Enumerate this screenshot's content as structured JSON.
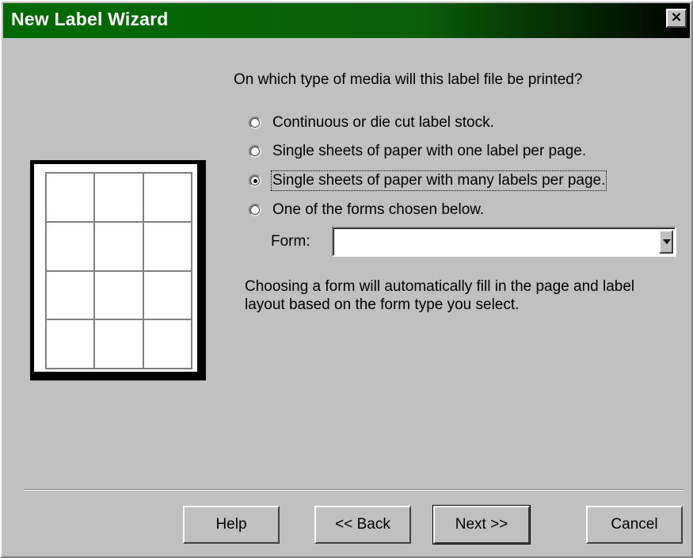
{
  "window": {
    "title": "New Label Wizard",
    "close_glyph": "×"
  },
  "question": "On which type of media will this label file be printed?",
  "options": [
    {
      "label": "Continuous or die cut label stock.",
      "checked": false
    },
    {
      "label": "Single sheets of paper with one label per page.",
      "checked": false
    },
    {
      "label": "Single sheets of paper with many labels per page.",
      "checked": true
    },
    {
      "label": "One of the forms chosen below.",
      "checked": false
    }
  ],
  "form": {
    "label": "Form:",
    "value": ""
  },
  "help_text": "Choosing a form will automatically fill in the page and label layout based on the form type you select.",
  "buttons": {
    "help": "Help",
    "back": "<< Back",
    "next": "Next >>",
    "cancel": "Cancel"
  },
  "colors": {
    "titlebar_start": "#006a00",
    "titlebar_end": "#000000",
    "face": "#c0c0c0"
  }
}
